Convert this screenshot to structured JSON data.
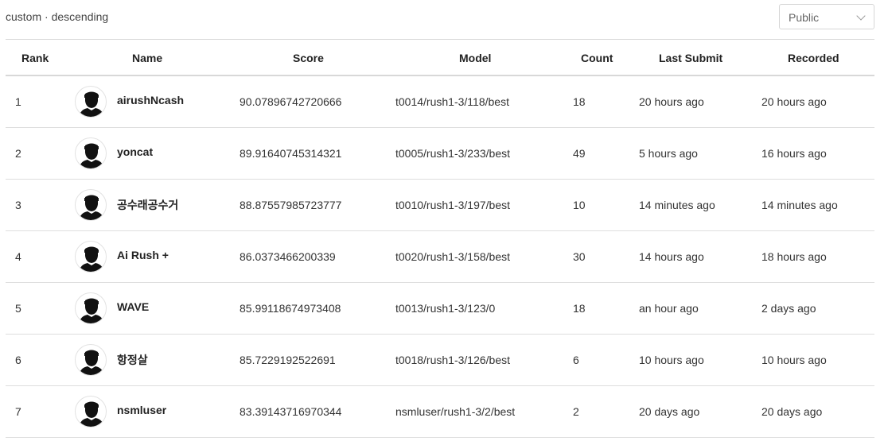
{
  "header": {
    "sort_label": "custom · descending",
    "visibility_select": {
      "value": "Public"
    }
  },
  "table": {
    "columns": [
      "Rank",
      "Name",
      "Score",
      "Model",
      "Count",
      "Last Submit",
      "Recorded"
    ],
    "rows": [
      {
        "rank": "1",
        "name": "airushNcash",
        "score": "90.07896742720666",
        "model": "t0014/rush1-3/118/best",
        "count": "18",
        "last_submit": "20 hours ago",
        "recorded": "20 hours ago"
      },
      {
        "rank": "2",
        "name": "yoncat",
        "score": "89.91640745314321",
        "model": "t0005/rush1-3/233/best",
        "count": "49",
        "last_submit": "5 hours ago",
        "recorded": "16 hours ago"
      },
      {
        "rank": "3",
        "name": "공수래공수거",
        "score": "88.87557985723777",
        "model": "t0010/rush1-3/197/best",
        "count": "10",
        "last_submit": "14 minutes ago",
        "recorded": "14 minutes ago"
      },
      {
        "rank": "4",
        "name": "Ai Rush +",
        "score": "86.0373466200339",
        "model": "t0020/rush1-3/158/best",
        "count": "30",
        "last_submit": "14 hours ago",
        "recorded": "18 hours ago"
      },
      {
        "rank": "5",
        "name": "WAVE",
        "score": "85.99118674973408",
        "model": "t0013/rush1-3/123/0",
        "count": "18",
        "last_submit": "an hour ago",
        "recorded": "2 days ago"
      },
      {
        "rank": "6",
        "name": "항정살",
        "score": "85.7229192522691",
        "model": "t0018/rush1-3/126/best",
        "count": "6",
        "last_submit": "10 hours ago",
        "recorded": "10 hours ago"
      },
      {
        "rank": "7",
        "name": "nsmluser",
        "score": "83.39143716970344",
        "model": "nsmluser/rush1-3/2/best",
        "count": "2",
        "last_submit": "20 days ago",
        "recorded": "20 days ago"
      }
    ]
  },
  "icons": {
    "avatar": "default-user-silhouette-icon",
    "select_arrow": "chevron-down-icon"
  }
}
